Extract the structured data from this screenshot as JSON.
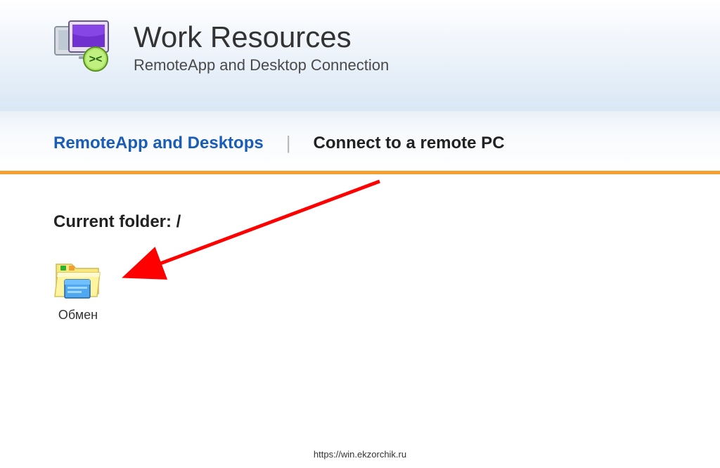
{
  "header": {
    "title": "Work Resources",
    "subtitle": "RemoteApp and Desktop Connection"
  },
  "tabs": {
    "active": "RemoteApp and Desktops",
    "inactive": "Connect to a remote PC",
    "separator": "|"
  },
  "content": {
    "current_folder_label": "Current folder: /",
    "apps": [
      {
        "label": "Обмен"
      }
    ]
  },
  "footer": {
    "url": "https://win.ekzorchik.ru"
  }
}
